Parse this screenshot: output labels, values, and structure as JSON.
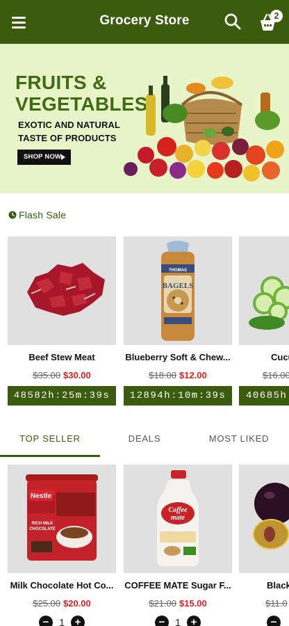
{
  "app": {
    "title": "Grocery Store",
    "cart_count": "2",
    "brand_color": "#3a5c0c"
  },
  "banner": {
    "headline_1": "FRUITS &",
    "headline_2": "VEGETABLES",
    "sub_1": "EXOTIC AND NATURAL",
    "sub_2": "TASTE OF PRODUCTS",
    "cta": "SHOP NOW"
  },
  "flash_sale": {
    "heading": "Flash Sale",
    "items": [
      {
        "name": "Beef Stew Meat",
        "old_price": "$35.00",
        "new_price": "$30.00",
        "timer": "48582h:25m:39s",
        "image": "beef-stew-meat"
      },
      {
        "name": "Blueberry Soft & Chew...",
        "old_price": "$18.00",
        "new_price": "$12.00",
        "timer": "12894h:10m:39s",
        "image": "bagels-bag"
      },
      {
        "name": "Cucu",
        "old_price": "$16.00",
        "new_price": "",
        "timer": "40685h:",
        "image": "cucumber-slices"
      }
    ]
  },
  "tabs": [
    {
      "label": "TOP SELLER",
      "active": true
    },
    {
      "label": "DEALS",
      "active": false
    },
    {
      "label": "MOST LIKED",
      "active": false
    }
  ],
  "top_seller": {
    "items": [
      {
        "name": "Milk Chocolate Hot Co...",
        "old_price": "$25.00",
        "new_price": "$20.00",
        "qty": "1",
        "image": "hot-cocoa-canister"
      },
      {
        "name": "COFFEE MATE Sugar F...",
        "old_price": "$21.00",
        "new_price": "$15.00",
        "qty": "1",
        "image": "creamer-bottle"
      },
      {
        "name": "Black",
        "old_price": "$11.0",
        "new_price": "",
        "qty": "",
        "image": "black-plum"
      }
    ]
  }
}
